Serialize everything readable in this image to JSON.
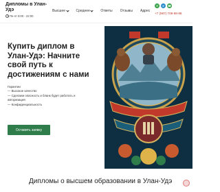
{
  "header": {
    "brand_title": "Дипломы в Улан-Удэ",
    "hours": "Пн-пт 8:00 - 22:00",
    "nav": [
      {
        "label": "Высшее",
        "has_dropdown": true
      },
      {
        "label": "Среднее",
        "has_dropdown": true
      },
      {
        "label": "Ответы",
        "has_dropdown": false
      },
      {
        "label": "Отзывы",
        "has_dropdown": false
      },
      {
        "label": "Адрес",
        "has_dropdown": false
      }
    ],
    "socials": [
      "whatsapp-icon",
      "telegram-icon",
      "phone-icon"
    ],
    "phone": "+7 (987) 708-88-98"
  },
  "hero": {
    "title": "Купить диплом в Улан-Удэ: Начните свой путь к достижениям с нами",
    "benefits_heading": "Гарантии",
    "benefits": [
      "— Высокое качество",
      "— Сделаем опасность и бланк будет работать и авторизация",
      "— Конфиденциальность"
    ],
    "cta_label": "Оставить заявку"
  },
  "section": {
    "title": "Дипломы о высшем образовании в Улан-Удэ"
  },
  "colors": {
    "accent": "#2f7d4a",
    "phone": "#c0392b"
  }
}
